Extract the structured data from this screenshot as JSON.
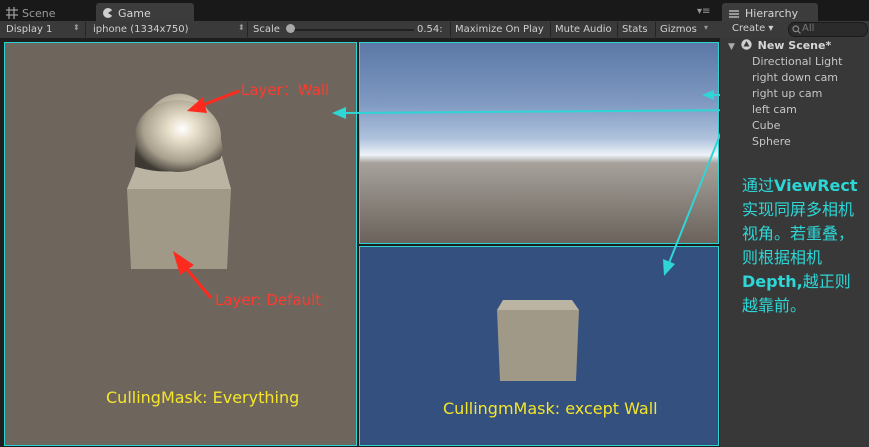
{
  "tabs": {
    "scene_label": "Scene",
    "game_label": "Game",
    "menu_glyph": "▾≡"
  },
  "toolbar": {
    "display": "Display 1",
    "resolution": "iphone (1334x750)",
    "scale_label": "Scale",
    "scale_value": "0.54:",
    "maximize": "Maximize On Play",
    "mute": "Mute Audio",
    "stats": "Stats",
    "gizmos": "Gizmos"
  },
  "annotations": {
    "layer_wall": "Layer：Wall",
    "layer_default": "Layer: Default",
    "culling_everything": "CullingMask: Everything",
    "culling_except": "CullingmMask: except Wall"
  },
  "hierarchy": {
    "tab_label": "Hierarchy",
    "create_label": "Create",
    "search_placeholder": "All",
    "scene_name": "New Scene*",
    "items": [
      "Directional Light",
      "right down cam",
      "right up cam",
      "left cam",
      "Cube",
      "Sphere"
    ]
  },
  "note": {
    "p1": "通过",
    "k1": "ViewRect",
    "p2": "实现同屏多相机视角。若重叠，则根据相机",
    "k2": "Depth,",
    "p3": "越正则越靠前。"
  },
  "colors": {
    "accent_cyan": "#2bd4d4",
    "annotation_red": "#ff3a2e",
    "caption_yellow": "#f5e62a"
  },
  "icons": [
    "grid-icon",
    "game-controller-icon",
    "tab-menu-icon",
    "hierarchy-list-icon",
    "search-icon",
    "unity-logo-icon"
  ]
}
